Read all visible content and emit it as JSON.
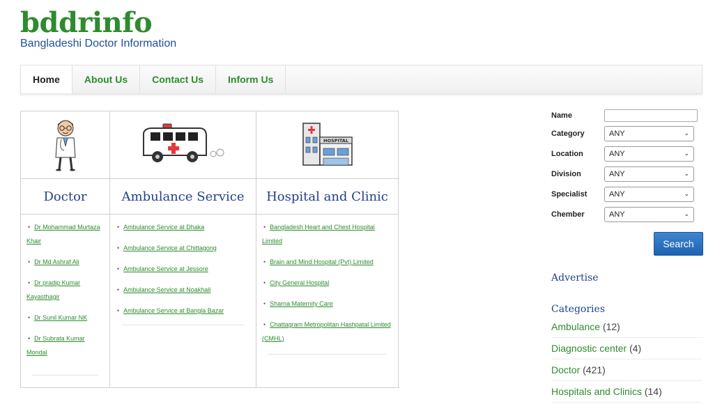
{
  "logo": {
    "title": "bddrinfo",
    "subtitle": "Bangladeshi Doctor Information"
  },
  "nav": [
    "Home",
    "About Us",
    "Contact Us",
    "Inform Us"
  ],
  "sections": [
    {
      "heading": "Doctor",
      "links": [
        "Dr Mohammad Murtaza Khair",
        "Dr Md Ashraf Ali",
        "Dr pradip Kumar Kayasthagir",
        "Dr Sunil Kumar NK",
        "Dr Subrata Kumar Mondal"
      ]
    },
    {
      "heading": "Ambulance Service",
      "links": [
        "Ambulance Service at Dhaka",
        "Ambulance Service at Chittagong",
        "Ambulance Service at Jessore",
        "Ambulance Service at Noakhali",
        "Ambulance Service at Bangla Bazar"
      ]
    },
    {
      "heading": "Hospital and Clinic",
      "links": [
        "Bangladesh Heart and Chest Hospital Limited",
        "Brain and Mind Hospital (Pvt) Limited",
        "City General Hospital",
        "Sharna Maternity Care",
        "Chattagram Metropolitan Hashpatal Limited (CMHL)"
      ]
    }
  ],
  "icons": {
    "doctor": "doctor-icon",
    "ambulance": "ambulance-icon",
    "hospital": "hospital-icon"
  },
  "hospital_sign": "HOSPITAL",
  "search_form": {
    "name_label": "Name",
    "name_value": "",
    "fields": [
      {
        "label": "Category",
        "value": "ANY"
      },
      {
        "label": "Location",
        "value": "ANY"
      },
      {
        "label": "Division",
        "value": "ANY"
      },
      {
        "label": "Specialist",
        "value": "ANY"
      },
      {
        "label": "Chember",
        "value": "ANY"
      }
    ],
    "button": "Search"
  },
  "advertise": "Advertise",
  "categories": {
    "heading": "Categories",
    "items": [
      {
        "name": "Ambulance",
        "count": "(12)"
      },
      {
        "name": "Diagnostic center",
        "count": "(4)"
      },
      {
        "name": "Doctor",
        "count": "(421)"
      },
      {
        "name": "Hospitals and Clinics",
        "count": "(14)"
      }
    ]
  },
  "colors": {
    "brand_green": "#2e8b2e",
    "heading_blue": "#233f8a",
    "button_blue": "#1f62b3"
  }
}
